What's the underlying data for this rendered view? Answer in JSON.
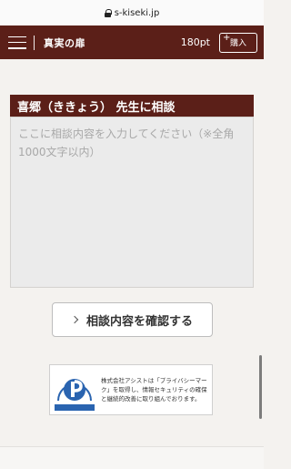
{
  "browser": {
    "url": "s-kiseki.jp"
  },
  "header": {
    "site_title": "真実の扉",
    "points": "180pt",
    "buy_label": "購入",
    "buy_plus": "+"
  },
  "counselor": {
    "heading": "喜郷（ききょう） 先生に相談"
  },
  "message": {
    "placeholder": "ここに相談内容を入力してください（※全角1000文字以内）",
    "value": ""
  },
  "confirm": {
    "label": "相談内容を確認する"
  },
  "privacy": {
    "mark_text": "たいせつにしますプライバシー",
    "mark_number": "17002075",
    "text": "株式会社アシストは「プライバシーマーク」を取得し、情報セキュリティの確保と継続的改善に取り組んでおります。"
  },
  "colors": {
    "brand": "#5b1f18",
    "page_bg": "#f4f2ef",
    "textarea_bg": "#ebebeb",
    "privacy_blue": "#2a64b0"
  },
  "icons": [
    "lock-icon",
    "hamburger-icon",
    "plus-icon",
    "chevron-right-icon",
    "privacy-mark-icon"
  ]
}
